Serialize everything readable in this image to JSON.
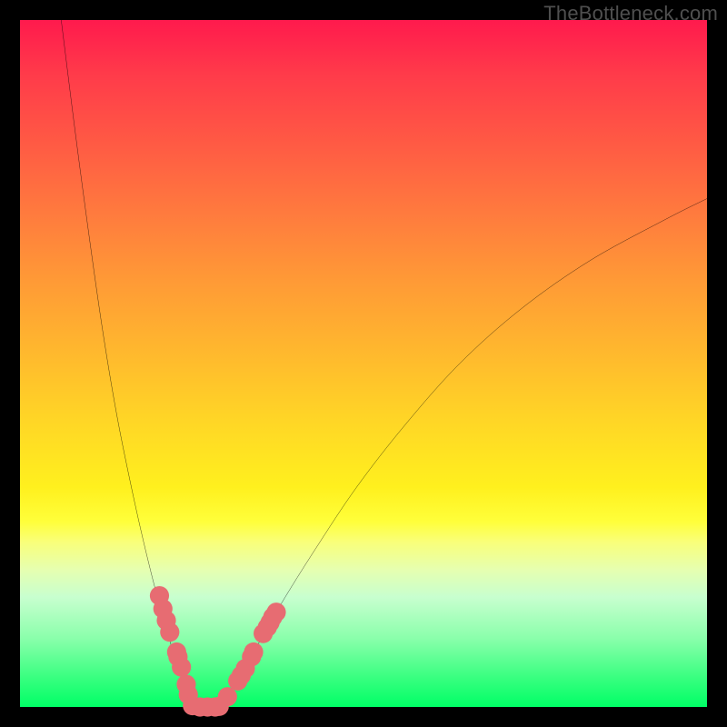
{
  "watermark": "TheBottleneck.com",
  "colors": {
    "accent_marker": "#e76c72",
    "curve_stroke": "#000000",
    "frame_bg": "#000000"
  },
  "chart_data": {
    "type": "line",
    "title": "",
    "xlabel": "",
    "ylabel": "",
    "xlim": [
      0,
      100
    ],
    "ylim": [
      0,
      100
    ],
    "grid": false,
    "legend": false,
    "series": [
      {
        "name": "left-branch",
        "x": [
          6,
          8,
          10,
          12,
          14,
          16,
          18,
          20,
          22,
          24,
          25
        ],
        "y": [
          100,
          84,
          69,
          55,
          43,
          33,
          24,
          16,
          9,
          3,
          0
        ]
      },
      {
        "name": "right-branch",
        "x": [
          29,
          31,
          34,
          38,
          43,
          49,
          56,
          64,
          73,
          83,
          94,
          100
        ],
        "y": [
          0,
          3,
          8,
          15,
          23,
          32,
          41,
          50,
          58,
          65,
          71,
          74
        ]
      }
    ],
    "marker_clusters": [
      {
        "name": "left-cluster",
        "points": [
          [
            20.3,
            16.2
          ],
          [
            20.8,
            14.3
          ],
          [
            21.3,
            12.6
          ],
          [
            21.8,
            10.9
          ],
          [
            22.8,
            8.0
          ],
          [
            23.0,
            7.3
          ],
          [
            23.5,
            5.8
          ],
          [
            24.2,
            3.3
          ],
          [
            24.5,
            1.8
          ]
        ],
        "size": 1.4
      },
      {
        "name": "bottom-flat",
        "points": [
          [
            25.1,
            0.2
          ],
          [
            26.2,
            0.0
          ],
          [
            27.3,
            0.0
          ],
          [
            28.4,
            0.0
          ]
        ],
        "size": 1.4
      },
      {
        "name": "right-cluster",
        "points": [
          [
            29.0,
            0.1
          ],
          [
            30.2,
            1.5
          ],
          [
            31.7,
            3.8
          ],
          [
            32.2,
            4.6
          ],
          [
            32.8,
            5.6
          ],
          [
            33.7,
            7.3
          ],
          [
            34.0,
            8.0
          ],
          [
            35.4,
            10.7
          ],
          [
            36.0,
            11.6
          ],
          [
            36.4,
            12.3
          ],
          [
            36.8,
            13.1
          ],
          [
            37.3,
            13.8
          ]
        ],
        "size": 1.4
      }
    ]
  }
}
